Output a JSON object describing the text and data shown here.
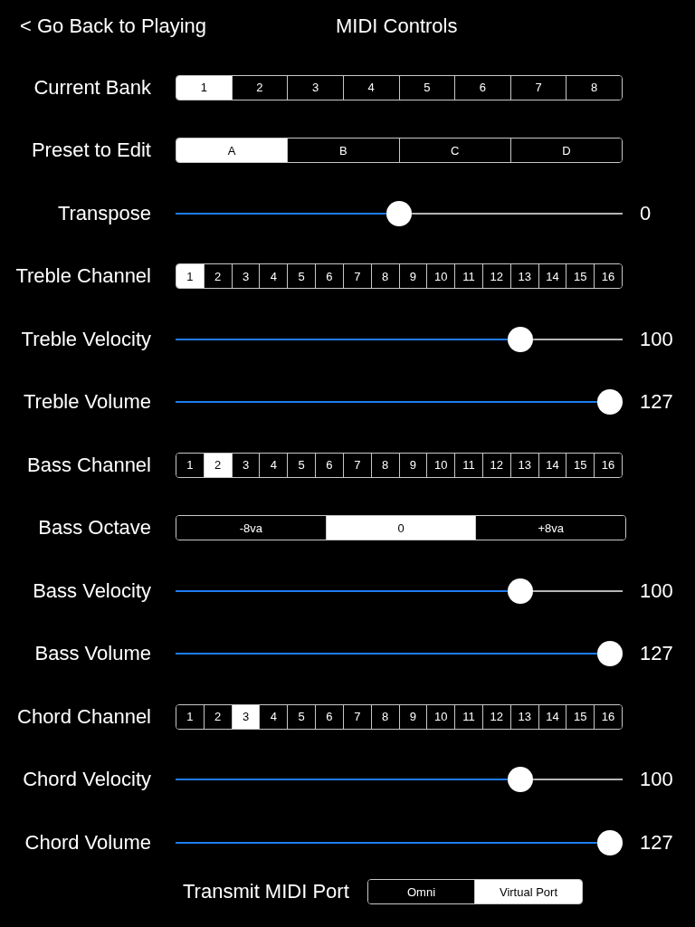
{
  "header": {
    "back_button": "< Go Back to Playing",
    "title": "MIDI Controls"
  },
  "rows": [
    {
      "kind": "segmented",
      "label": "Current Bank",
      "segments": [
        {
          "label": "1",
          "selected": true
        },
        {
          "label": "2",
          "selected": false
        },
        {
          "label": "3",
          "selected": false
        },
        {
          "label": "4",
          "selected": false
        },
        {
          "label": "5",
          "selected": false
        },
        {
          "label": "6",
          "selected": false
        },
        {
          "label": "7",
          "selected": false
        },
        {
          "label": "8",
          "selected": false
        }
      ]
    },
    {
      "kind": "segmented",
      "label": "Preset to Edit",
      "segments": [
        {
          "label": "A",
          "selected": true
        },
        {
          "label": "B",
          "selected": false
        },
        {
          "label": "C",
          "selected": false
        },
        {
          "label": "D",
          "selected": false
        }
      ]
    },
    {
      "kind": "slider",
      "label": "Transpose",
      "level": 0.5,
      "reading": "0"
    },
    {
      "kind": "segmented",
      "label": "Treble Channel",
      "segments": [
        {
          "label": "1",
          "selected": true
        },
        {
          "label": "2",
          "selected": false
        },
        {
          "label": "3",
          "selected": false
        },
        {
          "label": "4",
          "selected": false
        },
        {
          "label": "5",
          "selected": false
        },
        {
          "label": "6",
          "selected": false
        },
        {
          "label": "7",
          "selected": false
        },
        {
          "label": "8",
          "selected": false
        },
        {
          "label": "9",
          "selected": false
        },
        {
          "label": "10",
          "selected": false
        },
        {
          "label": "11",
          "selected": false
        },
        {
          "label": "12",
          "selected": false
        },
        {
          "label": "13",
          "selected": false
        },
        {
          "label": "14",
          "selected": false
        },
        {
          "label": "15",
          "selected": false
        },
        {
          "label": "16",
          "selected": false
        }
      ]
    },
    {
      "kind": "slider",
      "label": "Treble Velocity",
      "level": 0.787,
      "reading": "100"
    },
    {
      "kind": "slider",
      "label": "Treble Volume",
      "level": 1,
      "reading": "127"
    },
    {
      "kind": "segmented",
      "label": "Bass Channel",
      "segments": [
        {
          "label": "1",
          "selected": false
        },
        {
          "label": "2",
          "selected": true
        },
        {
          "label": "3",
          "selected": false
        },
        {
          "label": "4",
          "selected": false
        },
        {
          "label": "5",
          "selected": false
        },
        {
          "label": "6",
          "selected": false
        },
        {
          "label": "7",
          "selected": false
        },
        {
          "label": "8",
          "selected": false
        },
        {
          "label": "9",
          "selected": false
        },
        {
          "label": "10",
          "selected": false
        },
        {
          "label": "11",
          "selected": false
        },
        {
          "label": "12",
          "selected": false
        },
        {
          "label": "13",
          "selected": false
        },
        {
          "label": "14",
          "selected": false
        },
        {
          "label": "15",
          "selected": false
        },
        {
          "label": "16",
          "selected": false
        }
      ]
    },
    {
      "kind": "segmented",
      "label": "Bass Octave",
      "segments": [
        {
          "label": "-8va",
          "selected": false
        },
        {
          "label": "0",
          "selected": true
        },
        {
          "label": "+8va",
          "selected": false
        }
      ]
    },
    {
      "kind": "slider",
      "label": "Bass Velocity",
      "level": 0.787,
      "reading": "100"
    },
    {
      "kind": "slider",
      "label": "Bass Volume",
      "level": 1,
      "reading": "127"
    },
    {
      "kind": "segmented",
      "label": "Chord Channel",
      "segments": [
        {
          "label": "1",
          "selected": false
        },
        {
          "label": "2",
          "selected": false
        },
        {
          "label": "3",
          "selected": true
        },
        {
          "label": "4",
          "selected": false
        },
        {
          "label": "5",
          "selected": false
        },
        {
          "label": "6",
          "selected": false
        },
        {
          "label": "7",
          "selected": false
        },
        {
          "label": "8",
          "selected": false
        },
        {
          "label": "9",
          "selected": false
        },
        {
          "label": "10",
          "selected": false
        },
        {
          "label": "11",
          "selected": false
        },
        {
          "label": "12",
          "selected": false
        },
        {
          "label": "13",
          "selected": false
        },
        {
          "label": "14",
          "selected": false
        },
        {
          "label": "15",
          "selected": false
        },
        {
          "label": "16",
          "selected": false
        }
      ]
    },
    {
      "kind": "slider",
      "label": "Chord Velocity",
      "level": 0.787,
      "reading": "100"
    },
    {
      "kind": "slider",
      "label": "Chord Volume",
      "level": 1,
      "reading": "127"
    }
  ],
  "transmit_port": {
    "label": "Transmit MIDI Port",
    "segments": [
      {
        "label": "Omni",
        "selected": false
      },
      {
        "label": "Virtual Port",
        "selected": true
      }
    ]
  }
}
